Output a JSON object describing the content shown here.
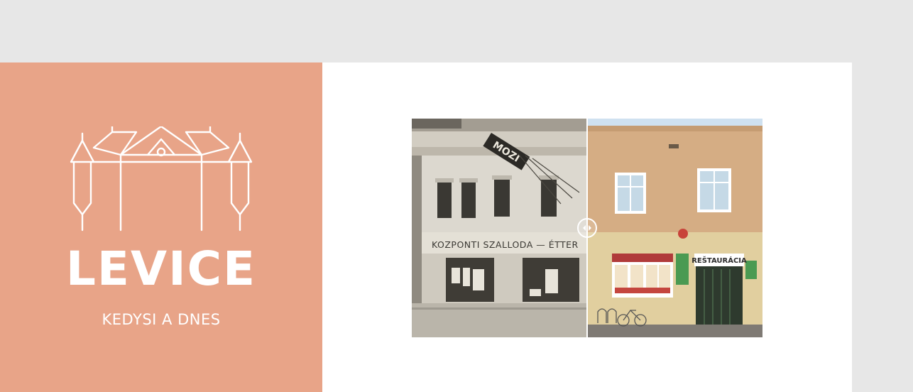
{
  "brand": {
    "title": "LEVICE",
    "subtitle": "KEDYSI A DNES",
    "logo_icon": "castle-outline-icon",
    "color": "#e8a488"
  },
  "comparison": {
    "handle_icon": "drag-handle-icon",
    "before_signs": {
      "vertical": "MOZI",
      "facade": "KOZPONTI SZALLODA — ÉTTER"
    },
    "after_signs": {
      "restaurant": "REŠTAURÁCIA"
    },
    "split_percent": 50
  }
}
